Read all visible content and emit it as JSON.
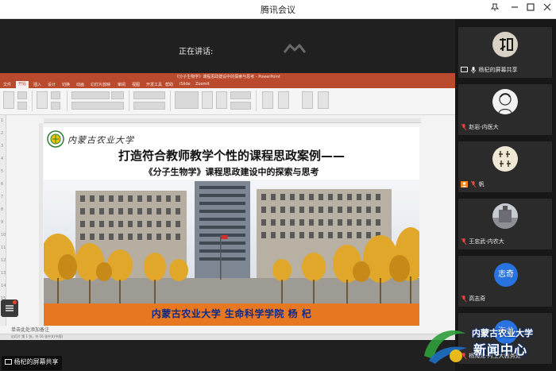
{
  "window": {
    "title": "腾讯会议"
  },
  "main": {
    "speaking_label": "正在讲话:",
    "bottom_share_label": "杨杞的屏幕共享"
  },
  "ppt": {
    "title_text": "《分子生物学》课程思政建设中的探索与思考 - PowerPoint",
    "tabs": [
      "文件",
      "开始",
      "插入",
      "设计",
      "切换",
      "动画",
      "幻灯片放映",
      "审阅",
      "视图",
      "开发工具",
      "帮助",
      "iSlide",
      "Zoomit"
    ],
    "active_tab": "开始",
    "notes_placeholder": "单击此处添加备注",
    "status_left": "幻灯片 第 1 张，共 16 张",
    "status_lang": "中文(中国)",
    "slide_count_labels": [
      "1",
      "2",
      "3",
      "4",
      "5",
      "6",
      "7",
      "8",
      "9",
      "10",
      "11",
      "12",
      "13",
      "14",
      "15",
      "16"
    ]
  },
  "slide": {
    "university_script": "内蒙古农业大学",
    "title_line1": "打造符合教师教学个性的课程思政案例——",
    "title_line2": "《分子生物学》课程思政建设中的探索与思考",
    "footer": "内蒙古农业大学 生命科学学院    杨  杞"
  },
  "participants": [
    {
      "name": "杨杞的屏幕共享",
      "type": "share"
    },
    {
      "name": "赵岩-内医大",
      "type": "photo"
    },
    {
      "name": "帆",
      "type": "calligraphy"
    },
    {
      "name": "王忠武-内农大",
      "type": "photo"
    },
    {
      "name": "高志奇",
      "type": "initial",
      "initial": "志奇",
      "color": "#2873e0"
    },
    {
      "name": "杨海龙-内工大教务处",
      "type": "initial",
      "initial": "海龙",
      "color": "#2873e0"
    }
  ],
  "watermark": {
    "line1": "内蒙古农业大学",
    "line2": "新闻中心"
  },
  "colors": {
    "ppt_accent": "#b94a2e",
    "slide_footer": "#e87722",
    "avatar_blue": "#2873e0"
  }
}
